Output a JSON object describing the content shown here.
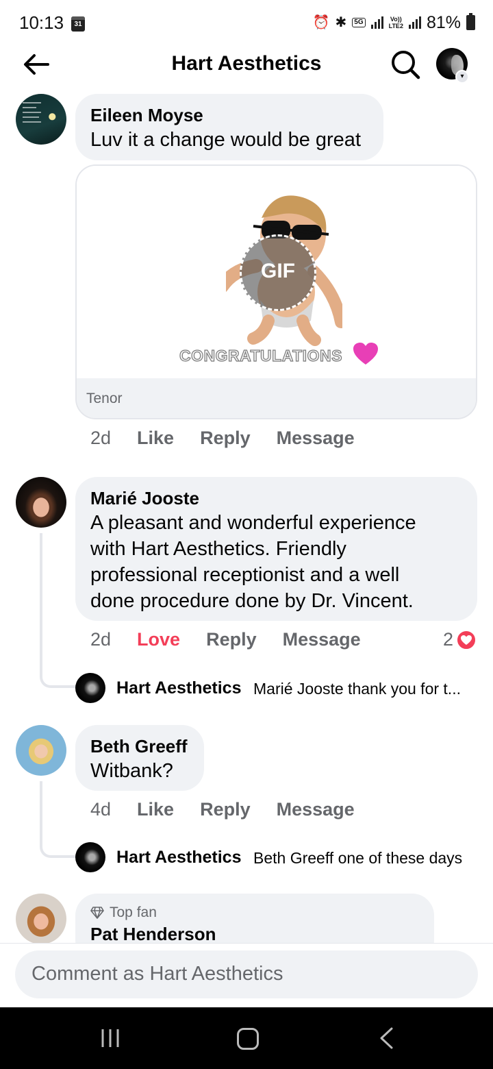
{
  "status_bar": {
    "time": "10:13",
    "calendar_day": "31",
    "network_tag": "5G",
    "volte_tag": "Vo)) LTE2",
    "battery": "81%"
  },
  "header": {
    "title": "Hart Aesthetics",
    "back_icon": "arrow-left-icon",
    "search_icon": "search-icon",
    "profile_icon": "profile-avatar"
  },
  "comments": [
    {
      "name": "Eileen Moyse",
      "text": "Luv it a change would be great",
      "gif": {
        "badge": "GIF",
        "caption": "CONGRATULATIONS",
        "source": "Tenor"
      },
      "time": "2d",
      "reaction_label": "Like",
      "reply_label": "Reply",
      "message_label": "Message"
    },
    {
      "name": "Marié Jooste",
      "text_lines": [
        "A pleasant and wonderful experience",
        "with Hart Aesthetics. Friendly",
        "professional receptionist and a well",
        "done procedure done by Dr. Vincent."
      ],
      "time": "2d",
      "reaction_label": "Love",
      "reply_label": "Reply",
      "message_label": "Message",
      "reaction_count": "2",
      "reply": {
        "name": "Hart Aesthetics",
        "text": "Marié Jooste thank you for t..."
      }
    },
    {
      "name": "Beth Greeff",
      "text": "Witbank?",
      "time": "4d",
      "reaction_label": "Like",
      "reply_label": "Reply",
      "message_label": "Message",
      "reply": {
        "name": "Hart Aesthetics",
        "text": "Beth Greeff one of these days"
      }
    },
    {
      "badge": "Top fan",
      "name": "Pat Henderson"
    }
  ],
  "composer": {
    "placeholder": "Comment as Hart Aesthetics"
  },
  "colors": {
    "love": "#f33e58",
    "bubble": "#f0f2f5",
    "secondary_text": "#65676b"
  }
}
